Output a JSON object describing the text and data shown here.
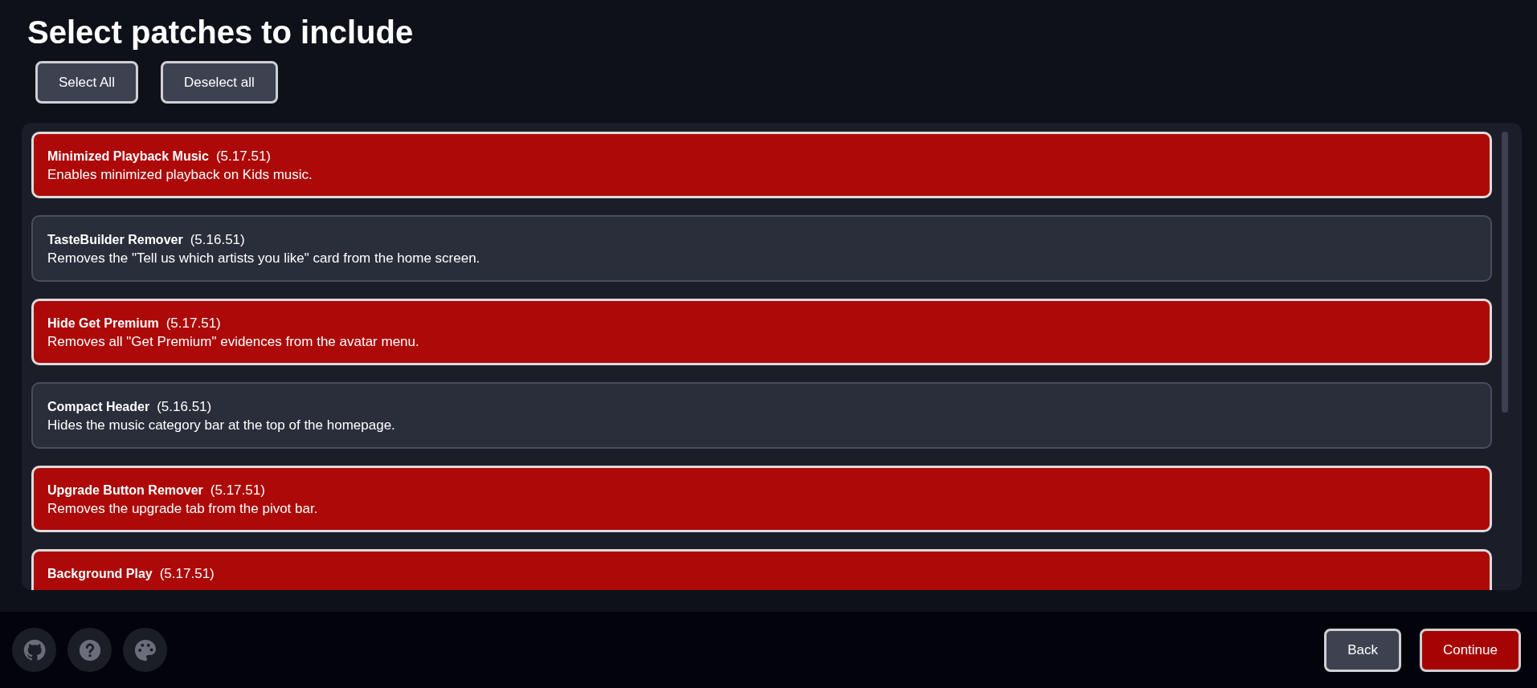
{
  "title": "Select patches to include",
  "actions": [
    "Select All",
    "Deselect all"
  ],
  "patches": [
    {
      "name": "Minimized Playback Music",
      "version": "(5.17.51)",
      "description": "Enables minimized playback on Kids music.",
      "selected": true
    },
    {
      "name": "TasteBuilder Remover",
      "version": "(5.16.51)",
      "description": "Removes the \"Tell us which artists you like\" card from the home screen.",
      "selected": false
    },
    {
      "name": "Hide Get Premium",
      "version": "(5.17.51)",
      "description": "Removes all \"Get Premium\" evidences from the avatar menu.",
      "selected": true
    },
    {
      "name": "Compact Header",
      "version": "(5.16.51)",
      "description": "Hides the music category bar at the top of the homepage.",
      "selected": false
    },
    {
      "name": "Upgrade Button Remover",
      "version": "(5.17.51)",
      "description": "Removes the upgrade tab from the pivot bar.",
      "selected": true
    },
    {
      "name": "Background Play",
      "version": "(5.17.51)",
      "selected": true
    }
  ],
  "footer": {
    "icons": [
      {
        "kind": "github"
      },
      {
        "kind": "help"
      },
      {
        "kind": "palette"
      }
    ],
    "buttons": [
      {
        "label": "Back",
        "kind": "secondary"
      },
      {
        "label": "Continue",
        "kind": "primary"
      }
    ]
  }
}
